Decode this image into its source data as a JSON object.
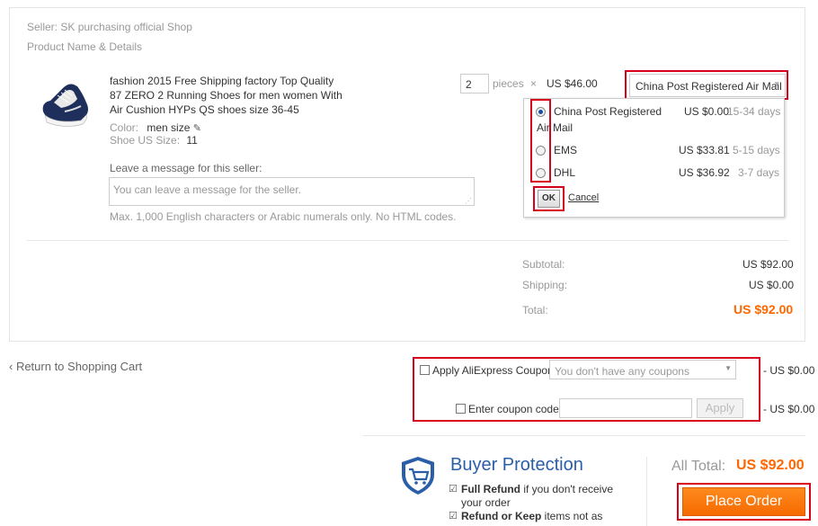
{
  "order": {
    "seller_label": "Seller: SK purchasing official Shop",
    "product_header": "Product Name & Details",
    "product": {
      "title": "fashion 2015 Free Shipping factory Top Quality 87 ZERO 2 Running Shoes for men women With Air Cushion HYPs QS shoes size 36-45",
      "color_label": "Color:",
      "color_value": "men size",
      "size_label": "Shoe US Size:",
      "size_value": "11",
      "quantity": "2",
      "pieces_label": "pieces",
      "times": "×",
      "unit_price": "US $46.00"
    },
    "message": {
      "label": "Leave a message for this seller:",
      "placeholder": "You can leave a message for the seller.",
      "hint": "Max. 1,000 English characters or Arabic numerals only. No HTML codes."
    },
    "shipping": {
      "selected": "China Post Registered Air Mail",
      "options": [
        {
          "name_line1": "China Post Registered",
          "name_line2": "Air Mail",
          "price": "US $0.00",
          "days": "15-34 days",
          "selected": true
        },
        {
          "name_line1": "EMS",
          "price": "US $33.81",
          "days": "5-15 days",
          "selected": false
        },
        {
          "name_line1": "DHL",
          "price": "US $36.92",
          "days": "3-7 days",
          "selected": false
        }
      ],
      "ok_label": "OK",
      "cancel_label": "Cancel"
    },
    "totals": {
      "subtotal_label": "Subtotal:",
      "subtotal_value": "US $92.00",
      "shipping_label": "Shipping:",
      "shipping_value": "US $0.00",
      "total_label": "Total:",
      "total_value": "US $92.00"
    }
  },
  "cart_link": "‹ Return to Shopping Cart",
  "coupon": {
    "apply_label": "Apply AliExpress Coupon:",
    "select_value": "You don't have any coupons",
    "apply_amount": "- US $0.00",
    "code_label": "Enter coupon code:",
    "apply_button": "Apply",
    "code_amount": "- US $0.00"
  },
  "protection": {
    "title": "Buyer Protection",
    "items": [
      {
        "bold": "Full Refund",
        "rest1": " if you don't receive",
        "rest2": "your order"
      },
      {
        "bold": "Refund or Keep",
        "rest1": " items not as",
        "rest2": ""
      }
    ]
  },
  "summary": {
    "all_total_label": "All Total:",
    "all_total_value": "US $92.00",
    "place_order": "Place Order"
  },
  "colors": {
    "accent_orange": "#ff6600",
    "highlight_red": "#d9001b",
    "brand_blue": "#2a5ea8"
  }
}
